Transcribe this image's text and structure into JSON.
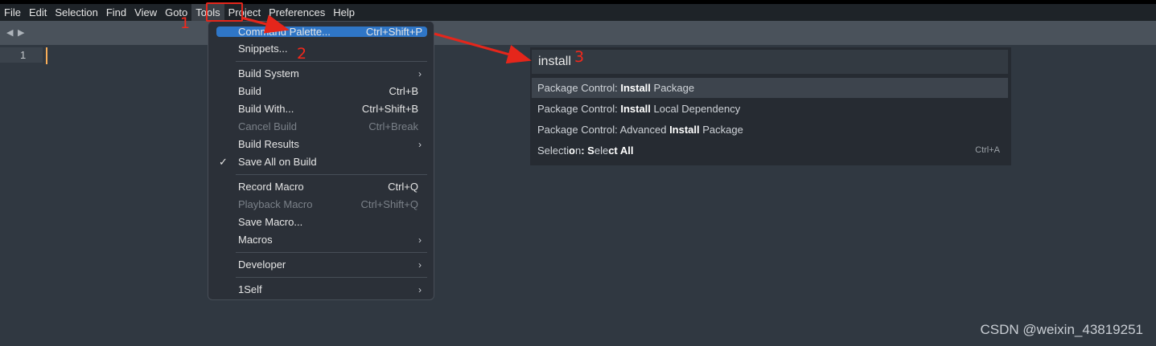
{
  "menubar": {
    "items": [
      "File",
      "Edit",
      "Selection",
      "Find",
      "View",
      "Goto",
      "Tools",
      "Project",
      "Preferences",
      "Help"
    ]
  },
  "editor": {
    "line_number": "1"
  },
  "tools_menu": {
    "command_palette": {
      "label": "Command Palette...",
      "shortcut": "Ctrl+Shift+P"
    },
    "snippets": {
      "label": "Snippets..."
    },
    "build_system": {
      "label": "Build System"
    },
    "build": {
      "label": "Build",
      "shortcut": "Ctrl+B"
    },
    "build_with": {
      "label": "Build With...",
      "shortcut": "Ctrl+Shift+B"
    },
    "cancel_build": {
      "label": "Cancel Build",
      "shortcut": "Ctrl+Break"
    },
    "build_results": {
      "label": "Build Results"
    },
    "save_all_on_build": {
      "label": "Save All on Build",
      "check": "✓"
    },
    "record_macro": {
      "label": "Record Macro",
      "shortcut": "Ctrl+Q"
    },
    "playback_macro": {
      "label": "Playback Macro",
      "shortcut": "Ctrl+Shift+Q"
    },
    "save_macro": {
      "label": "Save Macro..."
    },
    "macros": {
      "label": "Macros"
    },
    "developer": {
      "label": "Developer"
    },
    "oneself": {
      "label": "1Self"
    }
  },
  "palette": {
    "query": "install",
    "results": [
      {
        "prefix": "Package Control: ",
        "match": "Install",
        "suffix": " Package"
      },
      {
        "prefix": "Package Control: ",
        "match": "Install",
        "suffix": " Local Dependency"
      },
      {
        "prefix": "Package Control: Advanced ",
        "match": "Install",
        "suffix": " Package"
      },
      {
        "p1": "Selecti",
        "m1": "o",
        "p2": "n",
        "m2": ": S",
        "p3": "ele",
        "m3": "ct All",
        "shortcut": "Ctrl+A"
      }
    ]
  },
  "annotations": {
    "n1": "1",
    "n2": "2",
    "n3": "3"
  },
  "watermark": "CSDN @weixin_43819251",
  "colors": {
    "accent": "#2f76c7",
    "annotation": "#e5261b",
    "caret": "#f9ae58",
    "background": "#303841"
  }
}
